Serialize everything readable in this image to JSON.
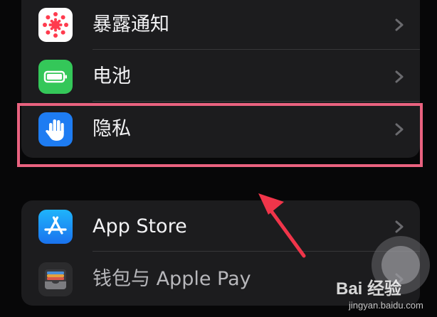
{
  "settings_list": {
    "group_one": [
      {
        "label": "暴露通知",
        "icon": "exposure-notification-icon"
      },
      {
        "label": "电池",
        "icon": "battery-icon"
      },
      {
        "label": "隐私",
        "icon": "privacy-hand-icon"
      }
    ],
    "group_two": [
      {
        "label": "App Store",
        "icon": "app-store-icon"
      },
      {
        "label": "钱包与 Apple Pay",
        "icon": "wallet-icon"
      }
    ]
  },
  "annotation": {
    "highlight_color": "#e9627f",
    "arrow_color": "#f0354a",
    "target": "隐私"
  },
  "watermark": {
    "logo": "Bai 经验",
    "url": "jingyan.baidu.com"
  },
  "colors": {
    "background": "#070708",
    "group_background": "#1c1c1e",
    "exposure_icon": "#ff3b4e",
    "battery_icon": "#34c759",
    "privacy_icon": "#1e7cf2",
    "app_store_icon": "#1a8df5"
  }
}
